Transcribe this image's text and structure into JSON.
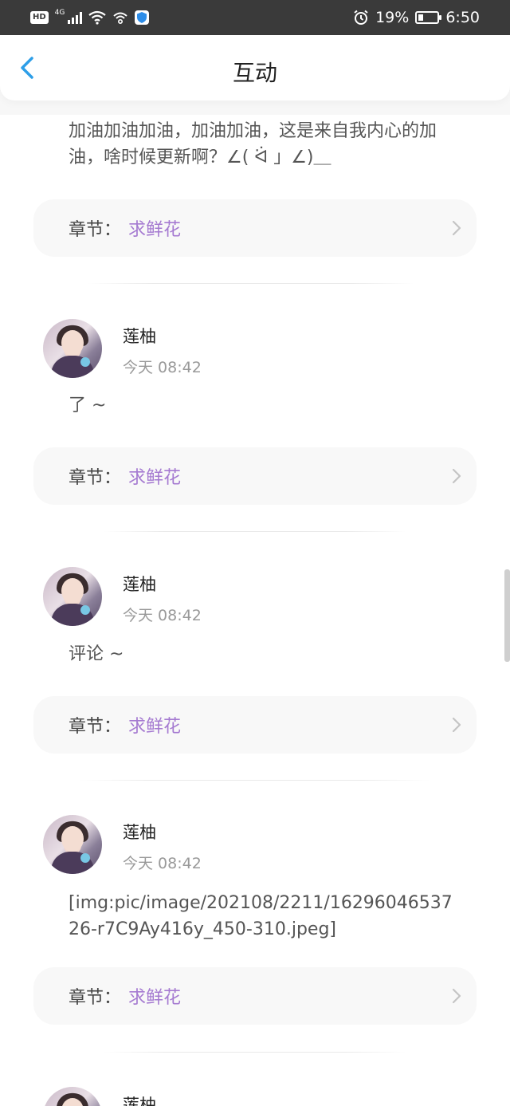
{
  "status_bar": {
    "hd": "HD",
    "network": "4G",
    "battery": "19%",
    "time": "6:50"
  },
  "header": {
    "title": "互动"
  },
  "top_comment": {
    "text": "加油加油加油，加油加油，这是来自我内心的加油，啥时候更新啊？∠( ᐛ 」∠)＿",
    "chapter_label": "章节：",
    "chapter_value": "求鲜花"
  },
  "comments": [
    {
      "user": "莲柚",
      "time": "今天 08:42",
      "text": "了 ~",
      "chapter_label": "章节：",
      "chapter_value": "求鲜花"
    },
    {
      "user": "莲柚",
      "time": "今天 08:42",
      "text": "评论 ~",
      "chapter_label": "章节：",
      "chapter_value": "求鲜花"
    },
    {
      "user": "莲柚",
      "time": "今天 08:42",
      "text": "[img:pic/image/202108/2211/1629604653726-r7C9Ay416y_450-310.jpeg]",
      "chapter_label": "章节：",
      "chapter_value": "求鲜花"
    },
    {
      "user": "莲柚"
    }
  ],
  "colors": {
    "accent_back": "#2d9ee8",
    "chapter_value": "#a57ad1"
  }
}
